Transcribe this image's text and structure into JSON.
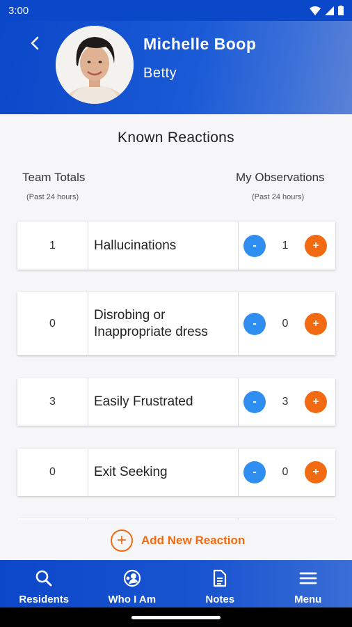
{
  "status_bar": {
    "time": "3:00"
  },
  "header": {
    "name": "Michelle Boop",
    "nickname": "Betty"
  },
  "section": {
    "title": "Known Reactions",
    "team_totals_label": "Team Totals",
    "team_totals_sub": "(Past 24 hours)",
    "my_obs_label": "My Observations",
    "my_obs_sub": "(Past 24 hours)"
  },
  "reactions": [
    {
      "team_total": "1",
      "label": "Hallucinations",
      "my_count": "1",
      "minus": "-",
      "plus": "+"
    },
    {
      "team_total": "0",
      "label": "Disrobing or Inappropriate dress",
      "my_count": "0",
      "minus": "-",
      "plus": "+"
    },
    {
      "team_total": "3",
      "label": "Easily Frustrated",
      "my_count": "3",
      "minus": "-",
      "plus": "+"
    },
    {
      "team_total": "0",
      "label": "Exit Seeking",
      "my_count": "0",
      "minus": "-",
      "plus": "+"
    }
  ],
  "add_reaction": {
    "label": "Add New Reaction",
    "icon": "+"
  },
  "bottom_nav": [
    {
      "label": "Residents",
      "icon": "search-icon"
    },
    {
      "label": "Who I Am",
      "icon": "person-icon"
    },
    {
      "label": "Notes",
      "icon": "document-icon"
    },
    {
      "label": "Menu",
      "icon": "menu-icon"
    }
  ],
  "colors": {
    "primary": "#0b47c9",
    "accent_orange": "#f26a12",
    "accent_blue": "#2f8ff0"
  }
}
